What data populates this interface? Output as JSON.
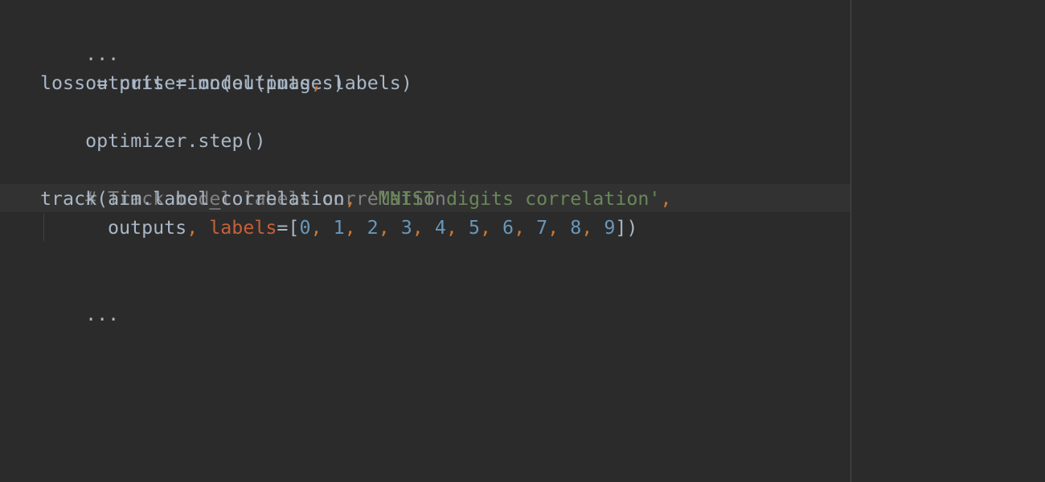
{
  "code": {
    "ellipsis_top": "...",
    "line_outputs": "outputs = model(images)",
    "line_loss_prefix": "loss = criterion(outputs",
    "line_loss_comma": ",",
    "line_loss_suffix": " labels)",
    "line_step": "optimizer.step()",
    "comment": "# Track model labels correlation",
    "track": {
      "call": "track(aim.label_correlation",
      "comma1": ",",
      "space": " ",
      "string_arg": "'MNIST digits correlation'",
      "comma2": ","
    },
    "cont": {
      "outputs": "outputs",
      "comma": ",",
      "space": " ",
      "kwarg": "labels",
      "equals_bracket": "=[",
      "numbers": [
        "0",
        "1",
        "2",
        "3",
        "4",
        "5",
        "6",
        "7",
        "8",
        "9"
      ],
      "sep": ", ",
      "closing": "])"
    },
    "ellipsis_bottom": "..."
  },
  "colors": {
    "background": "#2b2b2b",
    "text": "#a9b7c6",
    "comment": "#808080",
    "punctuation": "#cc7832",
    "keyword_argument": "#c6603a",
    "string": "#6a8759",
    "number": "#6897bb"
  }
}
